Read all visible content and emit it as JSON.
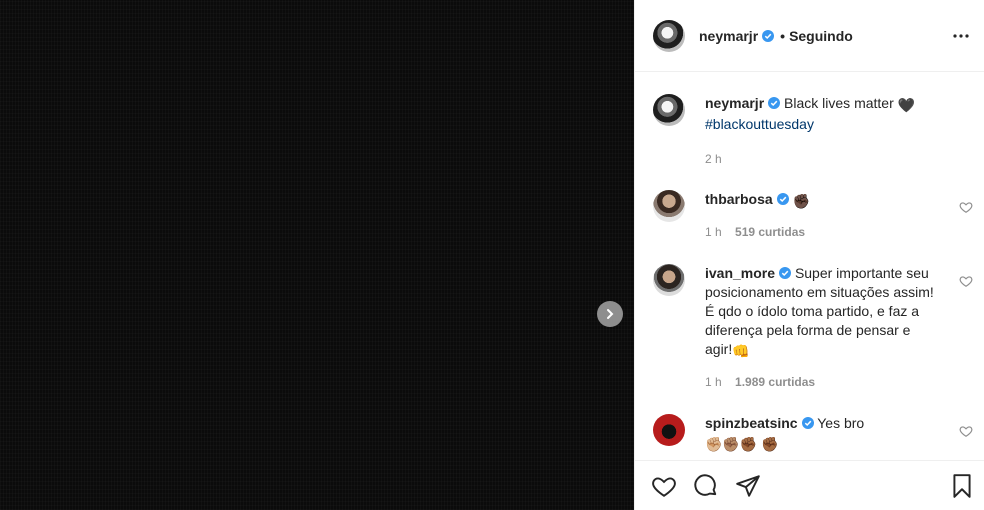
{
  "post": {
    "author": "neymarjr",
    "follow_separator": "•",
    "follow_label": "Seguindo",
    "caption_text": "Black lives matter",
    "caption_emoji": "🖤",
    "hashtag": "#blackouttuesday",
    "time": "2 h"
  },
  "comments": [
    {
      "user": "thbarbosa",
      "text": "",
      "emoji": "✊🏿",
      "time": "1 h",
      "likes": "519 curtidas"
    },
    {
      "user": "ivan_more",
      "text": "Super importante seu posicionamento em situações assim! É qdo o ídolo toma partido, e faz a diferença pela forma de pensar e agir!",
      "emoji": "👊",
      "time": "1 h",
      "likes": "1.989 curtidas"
    },
    {
      "user": "spinzbeatsinc",
      "text": "Yes bro",
      "emoji": "✊🏼✊🏽✊🏾 ✊🏾",
      "time": "",
      "likes": ""
    }
  ],
  "colors": {
    "verified": "#3897f0",
    "link": "#00376b",
    "muted": "#8e8e8e",
    "media_bg": "#0b0b0b"
  },
  "icons": [
    "chevron-right-icon",
    "verified-icon",
    "more-icon",
    "heart-icon",
    "comment-icon",
    "share-icon",
    "bookmark-icon"
  ]
}
